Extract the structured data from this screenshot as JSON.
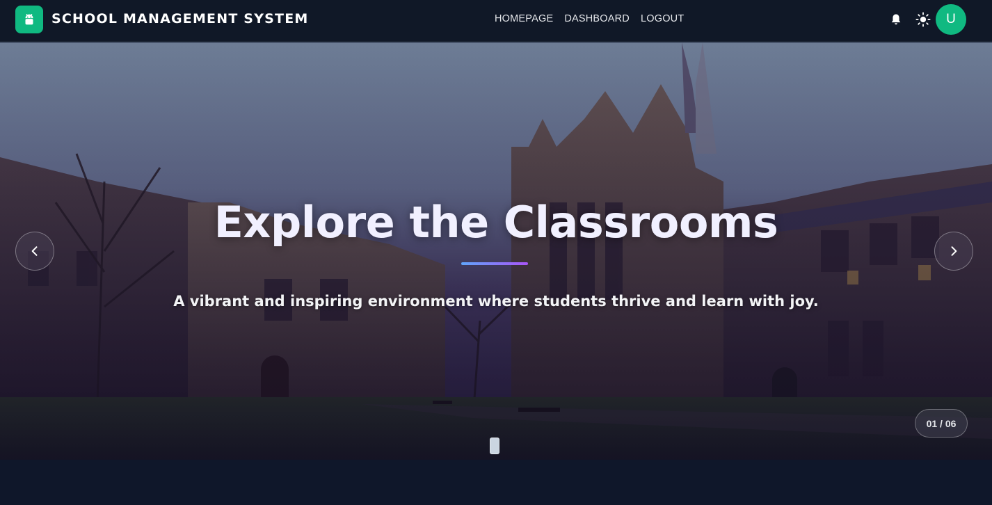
{
  "navbar": {
    "brand": "SCHOOL MANAGEMENT SYSTEM",
    "links": [
      "HOMEPAGE",
      "DASHBOARD",
      "LOGOUT"
    ],
    "avatar_initial": "U",
    "logo_icon": "android-icon",
    "accent": "#10b981"
  },
  "hero": {
    "title": "Explore the Classrooms",
    "subtitle": "A vibrant and inspiring environment where students thrive and learn with joy.",
    "counter": "01 / 06",
    "underline_colors": [
      "#60a5fa",
      "#a855f7"
    ]
  },
  "icons": {
    "notifications": "bell-icon",
    "theme": "sun-icon",
    "prev": "chevron-left-icon",
    "next": "chevron-right-icon"
  }
}
